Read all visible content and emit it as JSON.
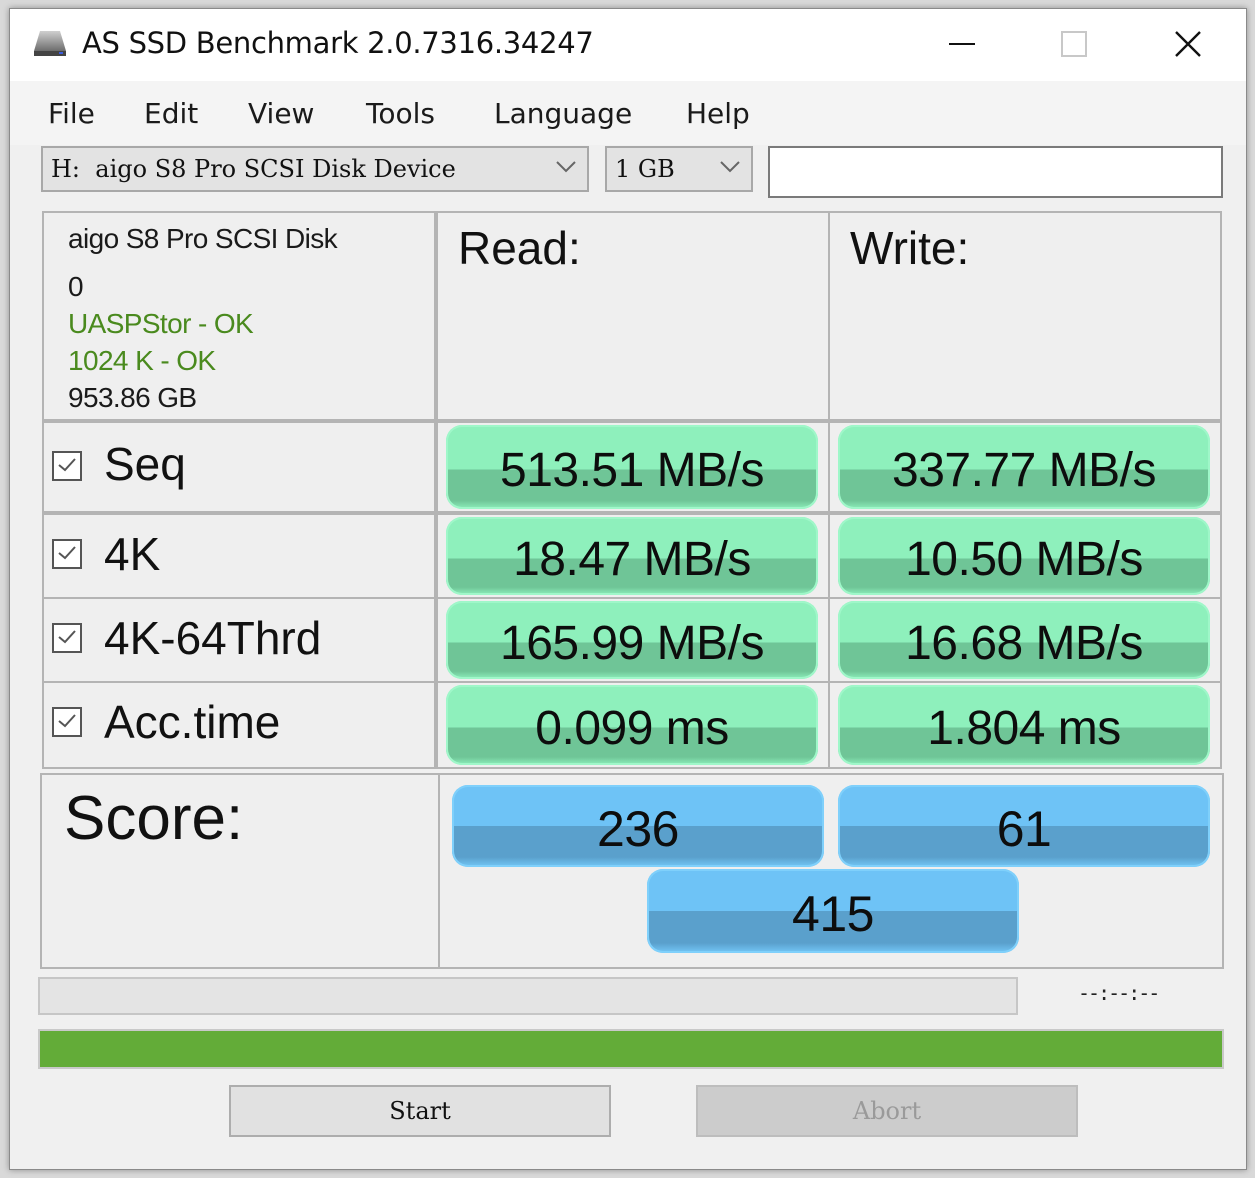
{
  "window": {
    "title": "AS SSD Benchmark 2.0.7316.34247",
    "controls": [
      "minimize",
      "maximize",
      "close"
    ]
  },
  "menu": [
    "File",
    "Edit",
    "View",
    "Tools",
    "Language",
    "Help"
  ],
  "toolbar": {
    "drive_select": "H:  aigo S8 Pro SCSI Disk Device",
    "size_select": "1 GB",
    "text_field_value": ""
  },
  "drive_info": {
    "name": "aigo S8 Pro SCSI Disk",
    "index": "0",
    "driver_status": "UASPStor - OK",
    "alignment_status": "1024 K - OK",
    "capacity": "953.86 GB",
    "ok_color": "#4a8a1e"
  },
  "headers": {
    "read": "Read:",
    "write": "Write:"
  },
  "tests": [
    {
      "label": "Seq",
      "checked": true,
      "read": "513.51 MB/s",
      "write": "337.77 MB/s"
    },
    {
      "label": "4K",
      "checked": true,
      "read": "18.47 MB/s",
      "write": "10.50 MB/s"
    },
    {
      "label": "4K-64Thrd",
      "checked": true,
      "read": "165.99 MB/s",
      "write": "16.68 MB/s"
    },
    {
      "label": "Acc.time",
      "checked": true,
      "read": "0.099 ms",
      "write": "1.804 ms"
    }
  ],
  "score": {
    "label": "Score:",
    "read": "236",
    "write": "61",
    "total": "415"
  },
  "progress": {
    "test_progress_percent": 0,
    "elapsed_time": "--:--:--",
    "overall_progress_percent": 100,
    "overall_color": "#63ac38"
  },
  "buttons": {
    "start": "Start",
    "abort": "Abort"
  }
}
